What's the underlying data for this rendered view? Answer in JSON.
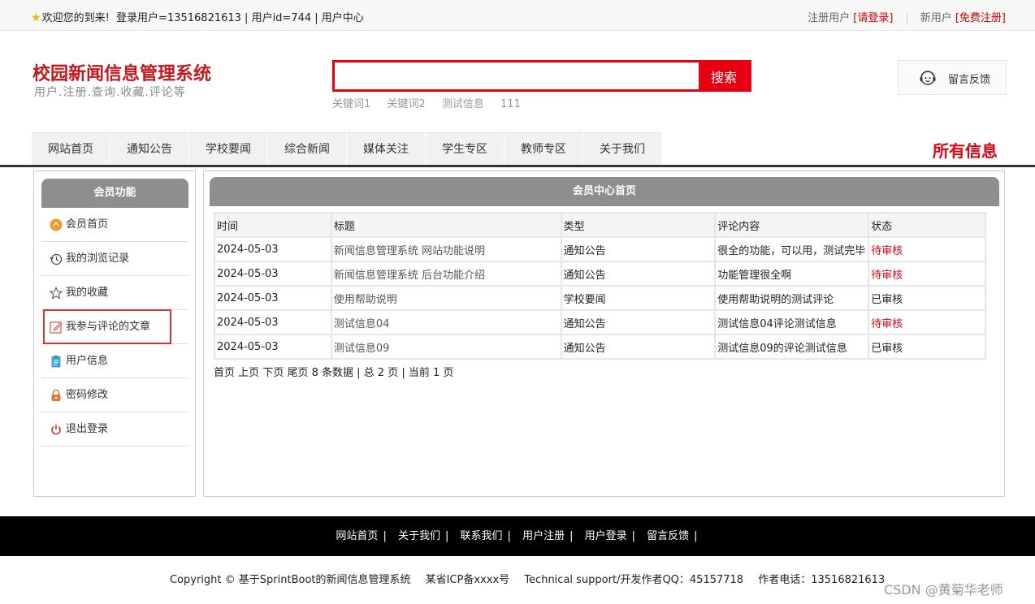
{
  "topbar": {
    "welcome": "欢迎您的到来!",
    "user_info": "登录用户=13516821613 | 用户id=744 | ",
    "user_center": "用户中心",
    "reg_label": "注册用户",
    "login_link": "[请登录]",
    "new_user_label": "新用户",
    "register_link": "[免费注册]"
  },
  "header": {
    "title": "校园新闻信息管理系统",
    "subtitle": "用户.注册.查询.收藏.评论等",
    "search_button": "搜索",
    "search_value": "",
    "keywords": [
      "关键词1",
      "关键词2",
      "测试信息",
      "111"
    ],
    "feedback": "留言反馈"
  },
  "nav": {
    "items": [
      "网站首页",
      "通知公告",
      "学校要闻",
      "综合新闻",
      "媒体关注",
      "学生专区",
      "教师专区",
      "关于我们"
    ],
    "all_info": "所有信息"
  },
  "sidebar": {
    "title": "会员功能",
    "items": [
      {
        "label": "会员首页",
        "icon": "home-icon"
      },
      {
        "label": "我的浏览记录",
        "icon": "history-icon"
      },
      {
        "label": "我的收藏",
        "icon": "star-icon"
      },
      {
        "label": "我参与评论的文章",
        "icon": "edit-icon"
      },
      {
        "label": "用户信息",
        "icon": "user-info-icon"
      },
      {
        "label": "密码修改",
        "icon": "lock-icon"
      },
      {
        "label": "退出登录",
        "icon": "power-icon"
      }
    ]
  },
  "main": {
    "title": "会员中心首页",
    "columns": [
      "时间",
      "标题",
      "类型",
      "评论内容",
      "状态"
    ],
    "rows": [
      [
        "2024-05-03",
        "新闻信息管理系统 网站功能说明",
        "通知公告",
        "很全的功能，可以用，测试完毕",
        "待审核"
      ],
      [
        "2024-05-03",
        "新闻信息管理系统 后台功能介绍",
        "通知公告",
        "功能管理很全啊",
        "待审核"
      ],
      [
        "2024-05-03",
        "使用帮助说明",
        "学校要闻",
        "使用帮助说明的测试评论",
        "已审核"
      ],
      [
        "2024-05-03",
        "测试信息04",
        "通知公告",
        "测试信息04评论测试信息",
        "待审核"
      ],
      [
        "2024-05-03",
        "测试信息09",
        "通知公告",
        "测试信息09的评论测试信息",
        "已审核"
      ]
    ],
    "pager": {
      "first": "首页",
      "prev": "上页",
      "next": "下页",
      "last": "尾页",
      "summary": "8 条数据 | 总 2 页 | 当前 1 页"
    }
  },
  "footer": {
    "links": [
      "网站首页",
      "关于我们",
      "联系我们",
      "用户注册",
      "用户登录",
      "留言反馈"
    ],
    "copyright": "Copyright © 基于SprintBoot的新闻信息管理系统",
    "icp": "某省ICP备xxxx号",
    "support": "Technical support/开发作者QQ：45157718",
    "phone": "作者电话：13516821613"
  },
  "watermark": "CSDN @黄菊华老师",
  "colors": {
    "brand_red": "#c8161d",
    "accent_red": "#e60012",
    "header_gray": "#8e8e8e"
  }
}
